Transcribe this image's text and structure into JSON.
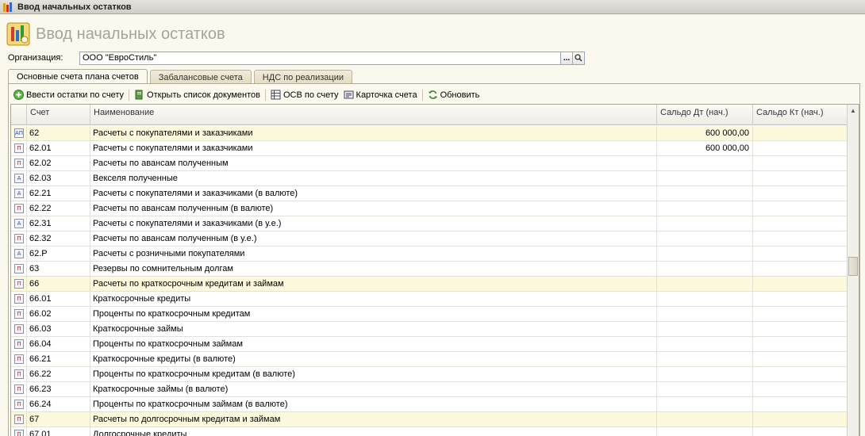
{
  "window": {
    "title": "Ввод начальных остатков"
  },
  "page": {
    "title": "Ввод начальных остатков"
  },
  "organization": {
    "label": "Организация:",
    "value": "ООО \"ЕвроСтиль\"",
    "select_button": "...",
    "search_button": "search-icon"
  },
  "tabs": [
    {
      "label": "Основные счета плана счетов",
      "active": true
    },
    {
      "label": "Забалансовые счета",
      "active": false
    },
    {
      "label": "НДС по реализации",
      "active": false
    }
  ],
  "toolbar": {
    "enter_balances": "Ввести остатки по счету",
    "open_docs": "Открыть список документов",
    "osv": "ОСВ по счету",
    "account_card": "Карточка счета",
    "refresh": "Обновить"
  },
  "table": {
    "columns": {
      "account": "Счет",
      "name": "Наименование",
      "debit": "Сальдо Дт (нач.)",
      "credit": "Сальдо Кт (нач.)"
    },
    "rows": [
      {
        "icon": "account-group-icon",
        "account": "62",
        "name": "Расчеты с покупателями и заказчиками",
        "debit": "600 000,00",
        "credit": "",
        "group": true
      },
      {
        "icon": "passive-account-icon",
        "account": "62.01",
        "name": "Расчеты с покупателями и заказчиками",
        "debit": "600 000,00",
        "credit": "",
        "group": false
      },
      {
        "icon": "passive-account-icon",
        "account": "62.02",
        "name": "Расчеты по авансам полученным",
        "debit": "",
        "credit": "",
        "group": false
      },
      {
        "icon": "active-account-icon",
        "account": "62.03",
        "name": "Векселя полученные",
        "debit": "",
        "credit": "",
        "group": false
      },
      {
        "icon": "active-account-icon",
        "account": "62.21",
        "name": "Расчеты с покупателями и заказчиками (в валюте)",
        "debit": "",
        "credit": "",
        "group": false
      },
      {
        "icon": "passive-account-icon",
        "account": "62.22",
        "name": "Расчеты по авансам полученным (в валюте)",
        "debit": "",
        "credit": "",
        "group": false
      },
      {
        "icon": "active-account-icon",
        "account": "62.31",
        "name": "Расчеты с покупателями и заказчиками (в у.е.)",
        "debit": "",
        "credit": "",
        "group": false
      },
      {
        "icon": "passive-account-icon",
        "account": "62.32",
        "name": "Расчеты по авансам полученным (в у.е.)",
        "debit": "",
        "credit": "",
        "group": false
      },
      {
        "icon": "active-account-icon",
        "account": "62.Р",
        "name": "Расчеты с розничными покупателями",
        "debit": "",
        "credit": "",
        "group": false
      },
      {
        "icon": "passive-account-icon",
        "account": "63",
        "name": "Резервы по сомнительным долгам",
        "debit": "",
        "credit": "",
        "group": false
      },
      {
        "icon": "passive-account-icon",
        "account": "66",
        "name": "Расчеты по краткосрочным кредитам и займам",
        "debit": "",
        "credit": "",
        "group": true
      },
      {
        "icon": "passive-account-icon",
        "account": "66.01",
        "name": "Краткосрочные кредиты",
        "debit": "",
        "credit": "",
        "group": false
      },
      {
        "icon": "passive-account-icon",
        "account": "66.02",
        "name": "Проценты по краткосрочным кредитам",
        "debit": "",
        "credit": "",
        "group": false
      },
      {
        "icon": "passive-account-icon",
        "account": "66.03",
        "name": "Краткосрочные займы",
        "debit": "",
        "credit": "",
        "group": false
      },
      {
        "icon": "passive-account-icon",
        "account": "66.04",
        "name": "Проценты по краткосрочным займам",
        "debit": "",
        "credit": "",
        "group": false
      },
      {
        "icon": "passive-account-icon",
        "account": "66.21",
        "name": "Краткосрочные кредиты (в валюте)",
        "debit": "",
        "credit": "",
        "group": false
      },
      {
        "icon": "passive-account-icon",
        "account": "66.22",
        "name": "Проценты по краткосрочным кредитам (в валюте)",
        "debit": "",
        "credit": "",
        "group": false
      },
      {
        "icon": "passive-account-icon",
        "account": "66.23",
        "name": "Краткосрочные займы (в валюте)",
        "debit": "",
        "credit": "",
        "group": false
      },
      {
        "icon": "passive-account-icon",
        "account": "66.24",
        "name": "Проценты по краткосрочным займам (в валюте)",
        "debit": "",
        "credit": "",
        "group": false
      },
      {
        "icon": "passive-account-icon",
        "account": "67",
        "name": "Расчеты по долгосрочным кредитам и займам",
        "debit": "",
        "credit": "",
        "group": true
      },
      {
        "icon": "passive-account-icon",
        "account": "67.01",
        "name": "Долгосрочные кредиты",
        "debit": "",
        "credit": "",
        "group": false
      }
    ]
  }
}
